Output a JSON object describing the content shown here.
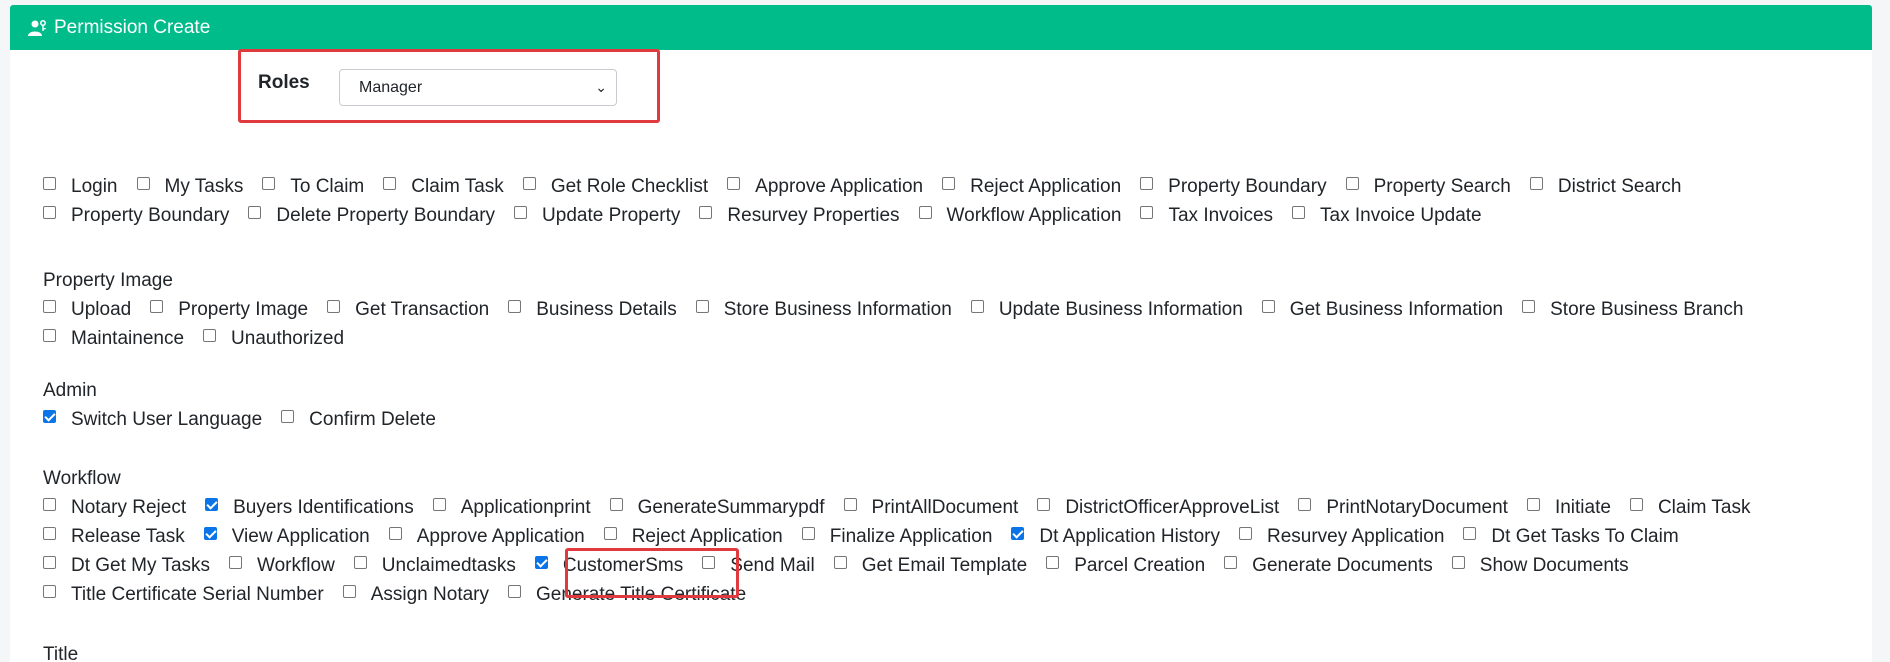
{
  "header": {
    "title": "Permission Create"
  },
  "roles": {
    "label": "Roles",
    "selected": "Manager"
  },
  "sections": [
    {
      "title": "",
      "rows": [
        [
          {
            "label": "Login",
            "checked": false
          },
          {
            "label": "My Tasks",
            "checked": false
          },
          {
            "label": "To Claim",
            "checked": false
          },
          {
            "label": "Claim Task",
            "checked": false
          },
          {
            "label": "Get Role Checklist",
            "checked": false
          },
          {
            "label": "Approve Application",
            "checked": false
          },
          {
            "label": "Reject Application",
            "checked": false
          },
          {
            "label": "Property Boundary",
            "checked": false
          },
          {
            "label": "Property Search",
            "checked": false
          },
          {
            "label": "District Search",
            "checked": false
          }
        ],
        [
          {
            "label": "Property Boundary",
            "checked": false
          },
          {
            "label": "Delete Property Boundary",
            "checked": false
          },
          {
            "label": "Update Property",
            "checked": false
          },
          {
            "label": "Resurvey Properties",
            "checked": false
          },
          {
            "label": "Workflow Application",
            "checked": false
          },
          {
            "label": "Tax Invoices",
            "checked": false
          },
          {
            "label": "Tax Invoice Update",
            "checked": false
          }
        ]
      ]
    },
    {
      "title": "Property Image",
      "rows": [
        [
          {
            "label": "Upload",
            "checked": false
          },
          {
            "label": "Property Image",
            "checked": false
          },
          {
            "label": "Get Transaction",
            "checked": false
          },
          {
            "label": "Business Details",
            "checked": false
          },
          {
            "label": "Store Business Information",
            "checked": false
          },
          {
            "label": "Update Business Information",
            "checked": false
          },
          {
            "label": "Get Business Information",
            "checked": false
          },
          {
            "label": "Store Business Branch",
            "checked": false
          }
        ],
        [
          {
            "label": "Maintainence",
            "checked": false
          },
          {
            "label": "Unauthorized",
            "checked": false
          }
        ]
      ]
    },
    {
      "title": "Admin",
      "rows": [
        [
          {
            "label": "Switch User Language",
            "checked": true
          },
          {
            "label": "Confirm Delete",
            "checked": false
          }
        ]
      ]
    },
    {
      "title": "Workflow",
      "rows": [
        [
          {
            "label": "Notary Reject",
            "checked": false
          },
          {
            "label": "Buyers Identifications",
            "checked": true
          },
          {
            "label": "Applicationprint",
            "checked": false
          },
          {
            "label": "GenerateSummarypdf",
            "checked": false
          },
          {
            "label": "PrintAllDocument",
            "checked": false
          },
          {
            "label": "DistrictOfficerApproveList",
            "checked": false
          },
          {
            "label": "PrintNotaryDocument",
            "checked": false
          },
          {
            "label": "Initiate",
            "checked": false
          },
          {
            "label": "Claim Task",
            "checked": false
          }
        ],
        [
          {
            "label": "Release Task",
            "checked": false
          },
          {
            "label": "View Application",
            "checked": true
          },
          {
            "label": "Approve Application",
            "checked": false
          },
          {
            "label": "Reject Application",
            "checked": false
          },
          {
            "label": "Finalize Application",
            "checked": false
          },
          {
            "label": "Dt Application History",
            "checked": true
          },
          {
            "label": "Resurvey Application",
            "checked": false
          },
          {
            "label": "Dt Get Tasks To Claim",
            "checked": false
          }
        ],
        [
          {
            "label": "Dt Get My Tasks",
            "checked": false
          },
          {
            "label": "Workflow",
            "checked": false
          },
          {
            "label": "Unclaimedtasks",
            "checked": false
          },
          {
            "label": "CustomerSms",
            "checked": true
          },
          {
            "label": "Send Mail",
            "checked": false
          },
          {
            "label": "Get Email Template",
            "checked": false
          },
          {
            "label": "Parcel Creation",
            "checked": false
          },
          {
            "label": "Generate Documents",
            "checked": false
          },
          {
            "label": "Show Documents",
            "checked": false
          }
        ],
        [
          {
            "label": "Title Certificate Serial Number",
            "checked": false
          },
          {
            "label": "Assign Notary",
            "checked": false
          },
          {
            "label": "Generate Title Certificate",
            "checked": false
          }
        ]
      ]
    },
    {
      "title": "Title",
      "rows": []
    }
  ]
}
